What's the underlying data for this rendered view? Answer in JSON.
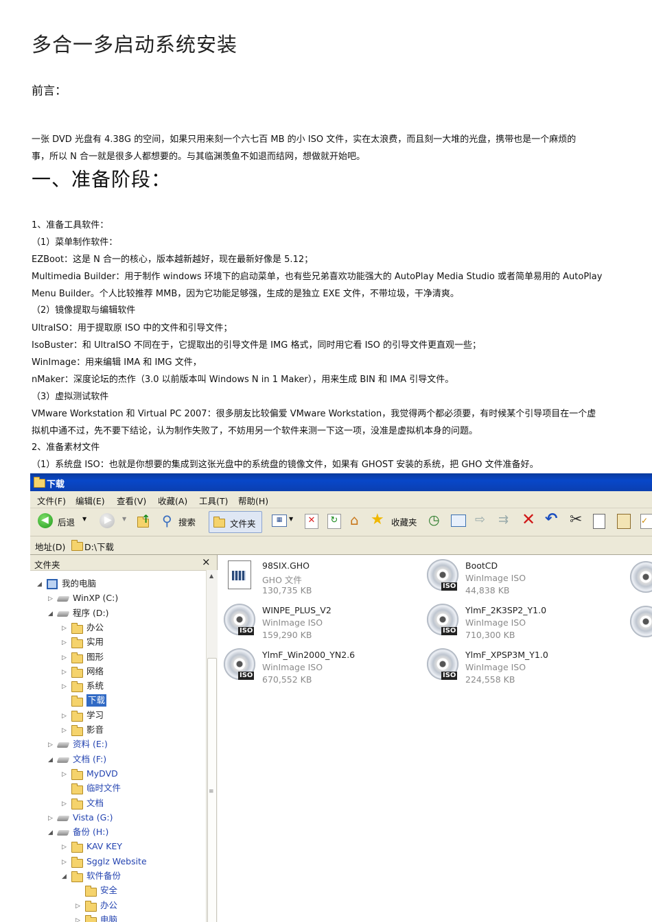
{
  "doc": {
    "title": "多合一多启动系统安装",
    "preface": "前言：",
    "intro_1": "一张 DVD 光盘有 4.38G 的空间，如果只用来刻一个六七百 MB 的小 ISO 文件，实在太浪费，而且刻一大堆的光盘，携带也是一个麻烦的",
    "intro_2": "事，所以 N 合一就是很多人都想要的。与其临渊羡鱼不如退而结网，想做就开始吧。",
    "section1": "一、准备阶段：",
    "lines": [
      "1、准备工具软件：",
      "（1）菜单制作软件：",
      "EZBoot：这是 N 合一的核心，版本越新越好，现在最新好像是 5.12；",
      "Multimedia Builder：用于制作 windows 环境下的启动菜单，也有些兄弟喜欢功能强大的 AutoPlay Media Studio 或者简单易用的 AutoPlay",
      "Menu Builder。个人比较推荐 MMB，因为它功能足够强，生成的是独立     EXE 文件，不带垃圾，干净清爽。",
      "（2）镜像提取与编辑软件",
      "UltraISO：用于提取原 ISO 中的文件和引导文件；",
      "IsoBuster：和 UltraISO 不同在于，它提取出的引导文件是 IMG 格式，同时用它看 ISO 的引导文件更直观一些；",
      "WinImage：用来编辑 IMA 和 IMG 文件，",
      "nMaker：深度论坛的杰作（3.0 以前版本叫 Windows N in 1 Maker），用来生成 BIN 和 IMA 引导文件。",
      "（3）虚拟测试软件",
      "VMware Workstation  和 Virtual PC 2007：很多朋友比较偏爱 VMware Workstation，我觉得两个都必须要，有时候某个引导项目在一个虚",
      "拟机中通不过，先不要下结论，认为制作失败了，不妨用另一个软件来测一下这一项，没准是虚拟机本身的问题。",
      "2、准备素材文件",
      "（1）系统盘  ISO：也就是你想要的集成到这张光盘中的系统盘的镜像文件，如果有  GHOST  安装的系统，把  GHO  文件准备好。"
    ]
  },
  "explorer": {
    "title": "下载",
    "menu": [
      "文件(F)",
      "编辑(E)",
      "查看(V)",
      "收藏(A)",
      "工具(T)",
      "帮助(H)"
    ],
    "toolbar": {
      "back": "后退",
      "search": "搜索",
      "folders": "文件夹",
      "favorites": "收藏夹"
    },
    "address_label": "地址(D)",
    "address_value": "D:\\下载",
    "sidebar_title": "文件夹",
    "sidebar_close": "×",
    "tree": [
      {
        "label": "我的电脑",
        "level": 0,
        "arrow": "◢",
        "icon": "computer-icon"
      },
      {
        "label": "WinXP (C:)",
        "level": 1,
        "arrow": "▷",
        "icon": "drive-icon"
      },
      {
        "label": "程序 (D:)",
        "level": 1,
        "arrow": "◢",
        "icon": "drive-icon"
      },
      {
        "label": "办公",
        "level": 2,
        "arrow": "▷",
        "icon": "folder-icon"
      },
      {
        "label": "实用",
        "level": 2,
        "arrow": "▷",
        "icon": "folder-icon"
      },
      {
        "label": "图形",
        "level": 2,
        "arrow": "▷",
        "icon": "folder-icon"
      },
      {
        "label": "网络",
        "level": 2,
        "arrow": "▷",
        "icon": "folder-icon"
      },
      {
        "label": "系统",
        "level": 2,
        "arrow": "▷",
        "icon": "folder-icon"
      },
      {
        "label": "下载",
        "level": 2,
        "arrow": "",
        "icon": "folder-icon",
        "selected": true
      },
      {
        "label": "学习",
        "level": 2,
        "arrow": "▷",
        "icon": "folder-icon"
      },
      {
        "label": "影音",
        "level": 2,
        "arrow": "▷",
        "icon": "folder-icon"
      },
      {
        "label": "资料 (E:)",
        "level": 1,
        "arrow": "▷",
        "icon": "drive-icon",
        "blue": true
      },
      {
        "label": "文档 (F:)",
        "level": 1,
        "arrow": "◢",
        "icon": "drive-icon",
        "blue": true
      },
      {
        "label": "MyDVD",
        "level": 2,
        "arrow": "▷",
        "icon": "folder-icon",
        "blue": true
      },
      {
        "label": "临时文件",
        "level": 2,
        "arrow": "",
        "icon": "folder-icon",
        "blue": true
      },
      {
        "label": "文档",
        "level": 2,
        "arrow": "▷",
        "icon": "folder-icon",
        "blue": true
      },
      {
        "label": "Vista (G:)",
        "level": 1,
        "arrow": "▷",
        "icon": "drive-icon",
        "blue": true
      },
      {
        "label": "备份 (H:)",
        "level": 1,
        "arrow": "◢",
        "icon": "drive-icon",
        "blue": true
      },
      {
        "label": "KAV KEY",
        "level": 2,
        "arrow": "▷",
        "icon": "folder-icon",
        "blue": true
      },
      {
        "label": "Sgglz Website",
        "level": 2,
        "arrow": "▷",
        "icon": "folder-icon",
        "blue": true
      },
      {
        "label": "软件备份",
        "level": 2,
        "arrow": "◢",
        "icon": "folder-icon",
        "blue": true
      },
      {
        "label": "安全",
        "level": 3,
        "arrow": "",
        "icon": "folder-icon",
        "blue": true
      },
      {
        "label": "办公",
        "level": 3,
        "arrow": "▷",
        "icon": "folder-icon",
        "blue": true
      },
      {
        "label": "电脑",
        "level": 3,
        "arrow": "▷",
        "icon": "folder-icon",
        "blue": true
      }
    ],
    "files": [
      {
        "name": "98SIX.GHO",
        "type": "GHO 文件",
        "size": "130,735 KB",
        "kind": "gho"
      },
      {
        "name": "BootCD",
        "type": "WinImage ISO",
        "size": "44,838 KB",
        "kind": "iso"
      },
      {
        "name": "WINPE_PLUS_V2",
        "type": "WinImage ISO",
        "size": "159,290 KB",
        "kind": "iso"
      },
      {
        "name": "YlmF_2K3SP2_Y1.0",
        "type": "WinImage ISO",
        "size": "710,300 KB",
        "kind": "iso"
      },
      {
        "name": "YlmF_Win2000_YN2.6",
        "type": "WinImage ISO",
        "size": "670,552 KB",
        "kind": "iso"
      },
      {
        "name": "YlmF_XPSP3M_Y1.0",
        "type": "WinImage ISO",
        "size": "224,558 KB",
        "kind": "iso"
      }
    ],
    "iso_tag": "ISO"
  }
}
